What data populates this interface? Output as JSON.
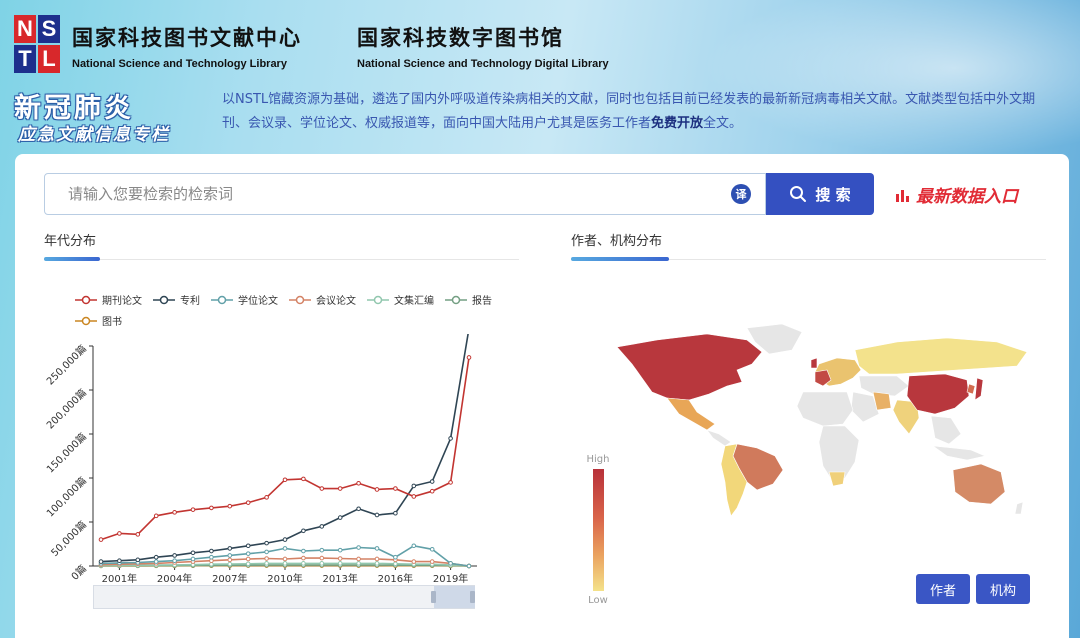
{
  "header": {
    "logo_letters": [
      "N",
      "S",
      "T",
      "L"
    ],
    "org1_cn": "国家科技图书文献中心",
    "org1_en": "National Science and Technology Library",
    "org2_cn": "国家科技数字图书馆",
    "org2_en": "National Science and Technology Digital Library"
  },
  "banner": {
    "title": "新冠肺炎",
    "subtitle": "应急文献信息专栏",
    "desc_part1": "以NSTL馆藏资源为基础，遴选了国内外呼吸道传染病相关的文献，同时也包括目前已经发表的最新新冠病毒相关文献。文献类型包括中外文期刊、会议录、学位论文、权威报道等，面向中国大陆用户尤其是医务工作者",
    "desc_bold": "免费开放",
    "desc_part2": "全文。"
  },
  "search": {
    "placeholder": "请输入您要检索的检索词",
    "value": "",
    "translate_label": "译",
    "button_label": "搜 索",
    "latest_link": "最新数据入口"
  },
  "sections": {
    "year_distribution": "年代分布",
    "author_org_distribution": "作者、机构分布"
  },
  "colors": {
    "series": [
      "#c23531",
      "#2f4554",
      "#61a0a8",
      "#d48265",
      "#91c7ae",
      "#749f83",
      "#ca8622"
    ],
    "accent": "#3450c1"
  },
  "chart_data": {
    "type": "line",
    "x": [
      "2000年",
      "2001年",
      "2002年",
      "2003年",
      "2004年",
      "2005年",
      "2006年",
      "2007年",
      "2008年",
      "2009年",
      "2010年",
      "2011年",
      "2012年",
      "2013年",
      "2014年",
      "2015年",
      "2016年",
      "2017年",
      "2018年",
      "2019年",
      "2020年"
    ],
    "x_tick_labels": [
      "2001年",
      "2004年",
      "2007年",
      "2010年",
      "2013年",
      "2016年",
      "2019年"
    ],
    "y_tick_labels": [
      "0篇",
      "50,000篇",
      "100,000篇",
      "150,000篇",
      "200,000篇",
      "250,000篇"
    ],
    "ylim": [
      0,
      250000
    ],
    "grid": false,
    "legend_position": "top-left",
    "series": [
      {
        "name": "期刊论文",
        "values": [
          30000,
          37000,
          36000,
          57000,
          61000,
          64000,
          66000,
          68000,
          72000,
          78000,
          98000,
          99000,
          88000,
          88000,
          94000,
          87000,
          88000,
          79000,
          85000,
          95000,
          237000
        ]
      },
      {
        "name": "专利",
        "values": [
          5000,
          6000,
          7000,
          10000,
          12000,
          15000,
          17000,
          20000,
          23000,
          26000,
          30000,
          40000,
          45000,
          55000,
          65000,
          58000,
          60000,
          91000,
          96000,
          145000,
          270000
        ]
      },
      {
        "name": "学位论文",
        "values": [
          3000,
          3500,
          4000,
          5000,
          6000,
          8000,
          10000,
          12000,
          14000,
          16000,
          20000,
          17000,
          18000,
          18000,
          21000,
          20000,
          10000,
          23000,
          19000,
          3000,
          0
        ]
      },
      {
        "name": "会议论文",
        "values": [
          1500,
          2000,
          2500,
          3000,
          4000,
          5000,
          6000,
          7000,
          8000,
          8500,
          8000,
          9000,
          9000,
          8500,
          8000,
          8000,
          7000,
          5000,
          5000,
          3000,
          0
        ]
      },
      {
        "name": "文集汇编",
        "values": [
          500,
          700,
          800,
          1000,
          1200,
          1500,
          2000,
          2200,
          2500,
          3000,
          3000,
          3000,
          3000,
          3000,
          3000,
          3000,
          2500,
          2000,
          2000,
          1000,
          0
        ]
      },
      {
        "name": "报告",
        "values": [
          200,
          300,
          300,
          400,
          500,
          600,
          700,
          800,
          900,
          1000,
          1000,
          1000,
          1000,
          1000,
          1000,
          1000,
          900,
          800,
          700,
          500,
          0
        ]
      },
      {
        "name": "图书",
        "values": [
          100,
          150,
          150,
          200,
          200,
          300,
          300,
          300,
          400,
          400,
          400,
          400,
          400,
          400,
          400,
          400,
          300,
          300,
          300,
          200,
          0
        ]
      }
    ]
  },
  "map": {
    "visual_map_high": "High",
    "visual_map_low": "Low",
    "buttons": [
      "作者",
      "机构"
    ]
  }
}
